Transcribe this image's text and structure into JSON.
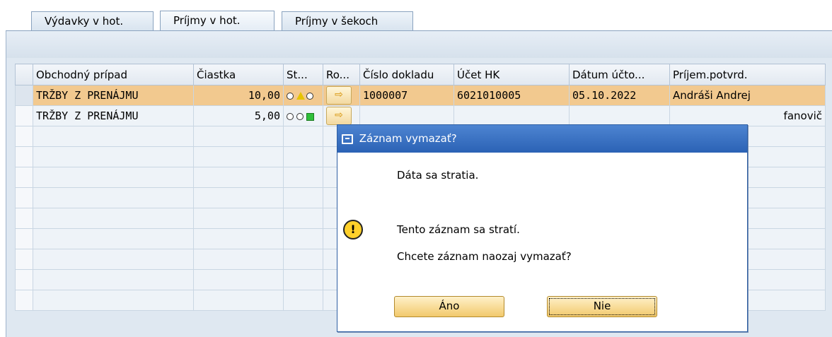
{
  "tabs": [
    {
      "label": "Výdavky v hot."
    },
    {
      "label": "Príjmy v hot."
    },
    {
      "label": "Príjmy v šekoch"
    }
  ],
  "table": {
    "headers": [
      "Obchodný prípad",
      "Čiastka",
      "St...",
      "Ro...",
      "Číslo dokladu",
      "Účet HK",
      "Dátum účto...",
      "Príjem.potvrd."
    ],
    "rows": [
      {
        "type": "TRŽBY Z PRENÁJMU",
        "amount": "10,00",
        "status": "yellow",
        "doc": "1000007",
        "account": "6021010005",
        "date": "05.10.2022",
        "recipient": "Andráši Andrej"
      },
      {
        "type": "TRŽBY Z PRENÁJMU",
        "amount": "5,00",
        "status": "green",
        "doc": "",
        "account": "",
        "date": "",
        "recipient": "fanovič"
      }
    ]
  },
  "dialog": {
    "title": "Záznam vymazať?",
    "line1": "Dáta sa stratia.",
    "line2": "Tento záznam sa stratí.",
    "line3": "Chcete záznam naozaj vymazať?",
    "yes_label": "Áno",
    "no_label": "Nie"
  },
  "colors": {
    "highlight_row": "#f2c98f",
    "dialog_title": "#2b62b5",
    "button": "#f2c96c"
  }
}
